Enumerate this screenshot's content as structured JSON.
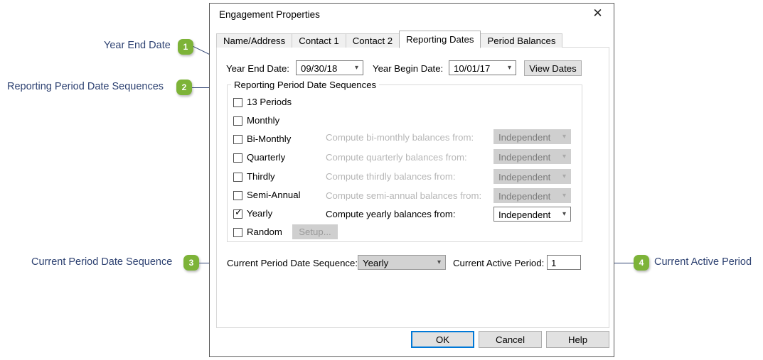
{
  "callouts": [
    {
      "number": "1",
      "label": "Year End Date"
    },
    {
      "number": "2",
      "label": "Reporting Period Date Sequences"
    },
    {
      "number": "3",
      "label": "Current Period Date Sequence"
    },
    {
      "number": "4",
      "label": "Current Active Period"
    }
  ],
  "dialog": {
    "title": "Engagement Properties",
    "close_icon": "✕",
    "tabs": [
      {
        "label": "Name/Address",
        "active": false
      },
      {
        "label": "Contact 1",
        "active": false
      },
      {
        "label": "Contact 2",
        "active": false
      },
      {
        "label": "Reporting Dates",
        "active": true
      },
      {
        "label": "Period Balances",
        "active": false
      }
    ],
    "dates_row": {
      "year_end_label": "Year End Date:",
      "year_end_value": "09/30/18",
      "year_begin_label": "Year Begin Date:",
      "year_begin_value": "10/01/17",
      "view_dates_label": "View Dates"
    },
    "groupbox": {
      "title": "Reporting Period Date Sequences",
      "rows": [
        {
          "checkbox_label": "13 Periods",
          "checked": false,
          "compute_label": "",
          "combo_value": "",
          "enabled": true
        },
        {
          "checkbox_label": "Monthly",
          "checked": false,
          "compute_label": "",
          "combo_value": "",
          "enabled": true
        },
        {
          "checkbox_label": "Bi-Monthly",
          "checked": false,
          "compute_label": "Compute bi-monthly balances from:",
          "combo_value": "Independent",
          "enabled": false
        },
        {
          "checkbox_label": "Quarterly",
          "checked": false,
          "compute_label": "Compute quarterly balances from:",
          "combo_value": "Independent",
          "enabled": false
        },
        {
          "checkbox_label": "Thirdly",
          "checked": false,
          "compute_label": "Compute thirdly balances from:",
          "combo_value": "Independent",
          "enabled": false
        },
        {
          "checkbox_label": "Semi-Annual",
          "checked": false,
          "compute_label": "Compute semi-annual balances from:",
          "combo_value": "Independent",
          "enabled": false
        },
        {
          "checkbox_label": "Yearly",
          "checked": true,
          "compute_label": "Compute yearly balances from:",
          "combo_value": "Independent",
          "enabled": true
        },
        {
          "checkbox_label": "Random",
          "checked": false,
          "compute_label": "",
          "combo_value": "",
          "enabled": true
        }
      ],
      "setup_button_label": "Setup..."
    },
    "bottom_row": {
      "sequence_label": "Current Period Date Sequence:",
      "sequence_value": "Yearly",
      "active_period_label": "Current Active Period:",
      "active_period_value": "1"
    },
    "buttons": {
      "ok": "OK",
      "cancel": "Cancel",
      "help": "Help"
    }
  },
  "colors": {
    "badge_green": "#7db338",
    "callout_navy": "#2e4272",
    "accent_blue": "#0078d7"
  }
}
